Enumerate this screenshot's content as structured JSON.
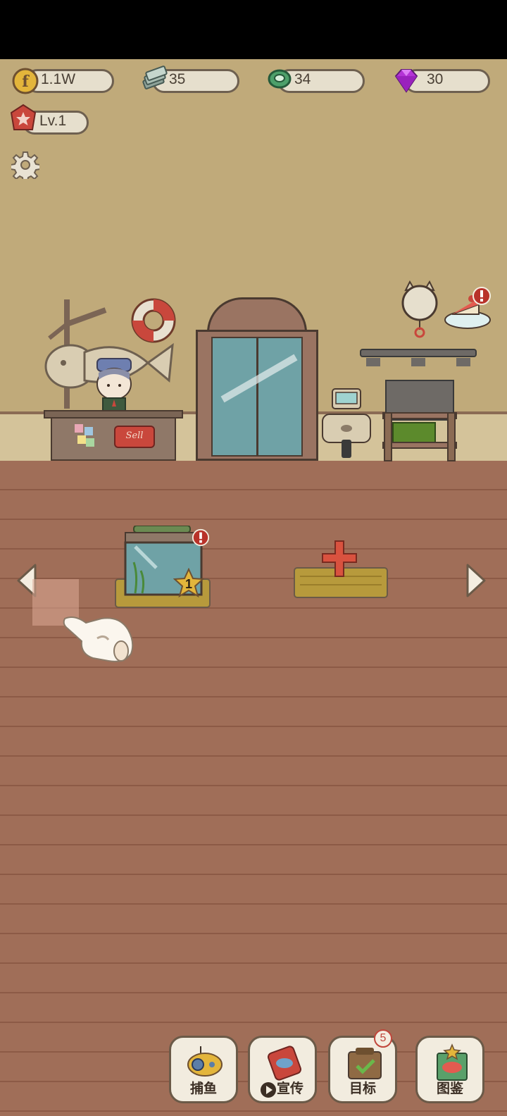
{
  "resources": {
    "coins": "1.1W",
    "cash": "35",
    "shells": "34",
    "gems": "30"
  },
  "level": "Lv.1",
  "counter": {
    "sign": "Sell"
  },
  "tank": {
    "star_count": "1"
  },
  "bottom_menu": [
    {
      "label": "捕鱼",
      "icon": "submarine-icon"
    },
    {
      "label": "宣传",
      "icon": "fish-can-icon"
    },
    {
      "label": "目标",
      "icon": "clipboard-check-icon",
      "badge": "5"
    },
    {
      "label": "图鉴",
      "icon": "fish-book-icon"
    }
  ],
  "colors": {
    "wall": "#c0aa7a",
    "floor": "#a06e58",
    "alert": "#b8322a",
    "star": "#e3b53b"
  }
}
